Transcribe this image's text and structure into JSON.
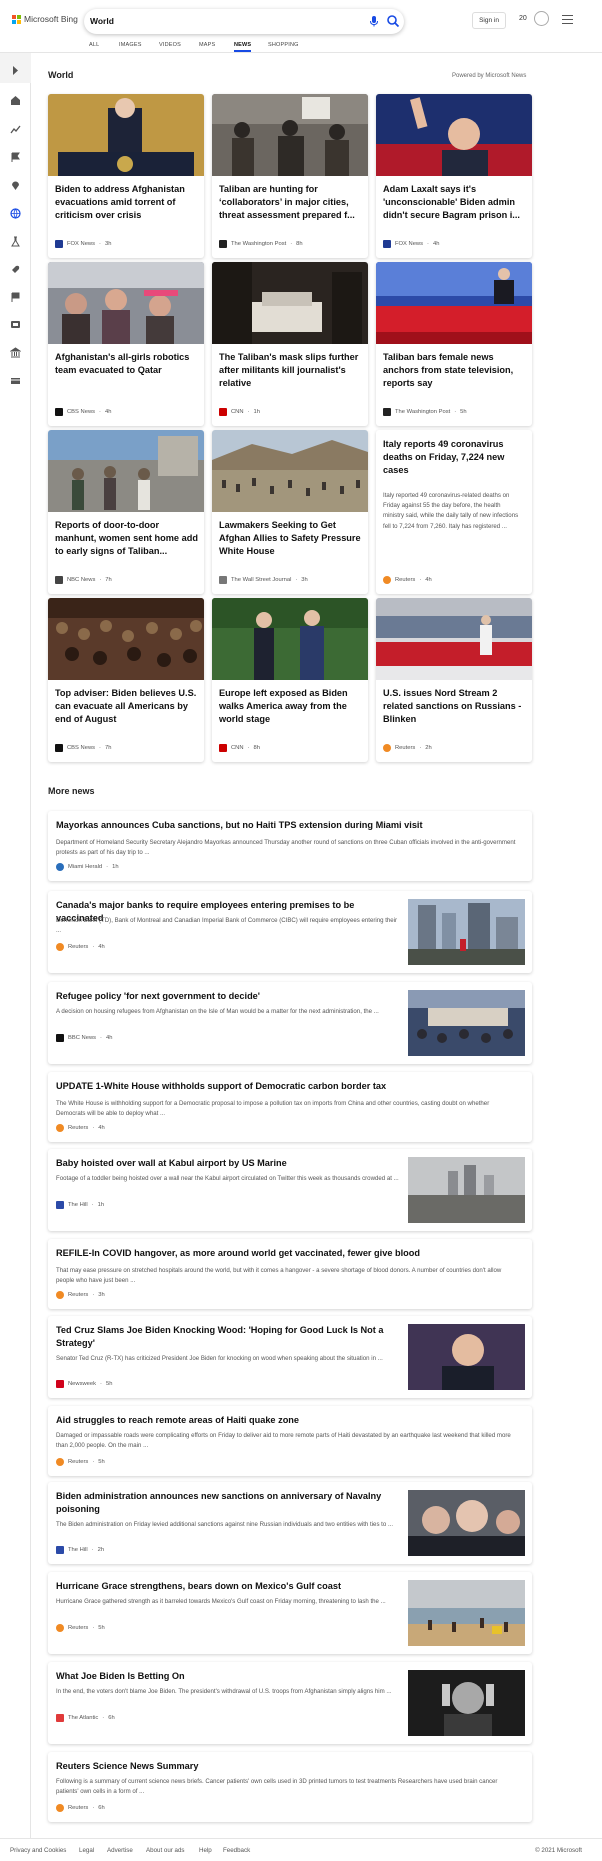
{
  "header": {
    "brand": "Microsoft Bing",
    "query": "World",
    "signin_label": "Sign in",
    "rewards_count": "20",
    "tabs": [
      {
        "label": "ALL"
      },
      {
        "label": "IMAGES"
      },
      {
        "label": "VIDEOS"
      },
      {
        "label": "MAPS"
      },
      {
        "label": "NEWS",
        "active": true
      },
      {
        "label": "SHOPPING"
      }
    ]
  },
  "rail": {
    "icons": [
      "expand-icon",
      "home-icon",
      "trending-icon",
      "flag-icon",
      "location-icon",
      "globe-icon",
      "science-icon",
      "rocket-icon",
      "flag-icon",
      "entertainment-icon",
      "politics-icon",
      "money-icon"
    ]
  },
  "section": {
    "title": "World",
    "powered_by": "Powered by Microsoft News"
  },
  "cards": [
    {
      "title": "Biden to address Afghanistan evacuations amid torrent of criticism over crisis",
      "source": "FOX News",
      "age": "3h",
      "logo_color": "#1f3a93"
    },
    {
      "title": "Taliban are hunting for ‘collaborators’ in major cities, threat assessment prepared f...",
      "source": "The Washington Post",
      "age": "8h",
      "logo_color": "#222222"
    },
    {
      "title": "Adam Laxalt says it's 'unconscionable' Biden admin didn't secure Bagram prison i...",
      "source": "FOX News",
      "age": "4h",
      "logo_color": "#1f3a93"
    },
    {
      "title": "Afghanistan's all-girls robotics team evacuated to Qatar",
      "source": "CBS News",
      "age": "4h",
      "logo_color": "#111111"
    },
    {
      "title": "The Taliban's mask slips further after militants kill journalist's relative",
      "source": "CNN",
      "age": "1h",
      "logo_color": "#cc0000"
    },
    {
      "title": "Taliban bars female news anchors from state television, reports say",
      "source": "The Washington Post",
      "age": "5h",
      "logo_color": "#222222"
    },
    {
      "title": "Reports of door-to-door manhunt, women sent home add to early signs of Taliban...",
      "source": "NBC News",
      "age": "7h",
      "logo_color": "#444444"
    },
    {
      "title": "Lawmakers Seeking to Get Afghan Allies to Safety Pressure White House",
      "source": "The Wall Street Journal",
      "age": "3h",
      "logo_color": "#777777"
    },
    {
      "title": "Italy reports 49 coronavirus deaths on Friday, 7,224 new cases",
      "description": "Italy reported 49 coronavirus-related deaths on Friday against 55 the day before, the health ministry said, while the daily tally of new infections fell to 7,224 from 7,260. Italy has registered ...",
      "source": "Reuters",
      "age": "4h",
      "logo_color": "#f08a24"
    },
    {
      "title": "Top adviser: Biden believes U.S. can evacuate all Americans by end of August",
      "source": "CBS News",
      "age": "7h",
      "logo_color": "#111111"
    },
    {
      "title": "Europe left exposed as Biden walks America away from the world stage",
      "source": "CNN",
      "age": "8h",
      "logo_color": "#cc0000"
    },
    {
      "title": "U.S. issues Nord Stream 2 related sanctions on Russians - Blinken",
      "source": "Reuters",
      "age": "2h",
      "logo_color": "#f08a24"
    }
  ],
  "more_news": {
    "title": "More news",
    "items": [
      {
        "title": "Mayorkas announces Cuba sanctions, but no Haiti TPS extension during Miami visit",
        "description": "Department of Homeland Security Secretary Alejandro Mayorkas announced Thursday another round of sanctions on three Cuban officials involved in the anti-government protests as part of his day trip to ...",
        "source": "Miami Herald",
        "age": "1h",
        "logo_color": "#2a6ebb"
      },
      {
        "title": "Canada's major banks to require employees entering premises to be vaccinated",
        "description": "Dominion Bank (TD), Bank of Montreal and Canadian Imperial Bank of Commerce (CIBC) will require employees entering their ...",
        "source": "Reuters",
        "age": "4h",
        "logo_color": "#f08a24"
      },
      {
        "title": "Refugee policy 'for next government to decide'",
        "description": "A decision on housing refugees from Afghanistan on the Isle of Man would be a matter for the next administration, the ...",
        "source": "BBC News",
        "age": "4h",
        "logo_color": "#111111"
      },
      {
        "title": "UPDATE 1-White House withholds support of Democratic carbon border tax",
        "description": "The White House is withholding support for a Democratic proposal to impose a pollution tax on imports from China and other countries, casting doubt on whether Democrats will be able to deploy what ...",
        "source": "Reuters",
        "age": "4h",
        "logo_color": "#f08a24"
      },
      {
        "title": "Baby hoisted over wall at Kabul airport by US Marine",
        "description": "Footage of a toddler being hoisted over a wall near the Kabul airport circulated on Twitter this week as thousands crowded at ...",
        "source": "The Hill",
        "age": "1h",
        "logo_color": "#2b4aa8"
      },
      {
        "title": "REFILE-In COVID hangover, as more around world get vaccinated, fewer give blood",
        "description": "That may ease pressure on stretched hospitals around the world, but with it comes a hangover - a severe shortage of blood donors. A number of countries don't allow people who have just been ...",
        "source": "Reuters",
        "age": "3h",
        "logo_color": "#f08a24"
      },
      {
        "title": "Ted Cruz Slams Joe Biden Knocking Wood: 'Hoping for Good Luck Is Not a Strategy'",
        "description": "Senator Ted Cruz (R-TX) has criticized President Joe Biden for knocking on wood when speaking about the situation in ...",
        "source": "Newsweek",
        "age": "5h",
        "logo_color": "#d0021b"
      },
      {
        "title": "Aid struggles to reach remote areas of Haiti quake zone",
        "description": "Damaged or impassable roads were complicating efforts on Friday to deliver aid to more remote parts of Haiti devastated by an earthquake last weekend that killed more than 2,000 people. On the main ...",
        "source": "Reuters",
        "age": "5h",
        "logo_color": "#f08a24"
      },
      {
        "title": "Biden administration announces new sanctions on anniversary of Navalny poisoning",
        "description": "The Biden administration on Friday levied additional sanctions against nine Russian individuals and two entities with ties to ...",
        "source": "The Hill",
        "age": "2h",
        "logo_color": "#2b4aa8"
      },
      {
        "title": "Hurricane Grace strengthens, bears down on Mexico's Gulf coast",
        "description": "Hurricane Grace gathered strength as it barreled towards Mexico's Gulf coast on Friday morning, threatening to lash the ...",
        "source": "Reuters",
        "age": "5h",
        "logo_color": "#f08a24"
      },
      {
        "title": "What Joe Biden Is Betting On",
        "description": "In the end, the voters don't blame Joe Biden. The president's withdrawal of U.S. troops from Afghanistan simply aligns him ...",
        "source": "The Atlantic",
        "age": "6h",
        "logo_color": "#e03a3a"
      },
      {
        "title": "Reuters Science News Summary",
        "description": "Following is a summary of current science news briefs. Cancer patients' own cells used in 3D printed tumors to test treatments Researchers have used brain cancer patients' own cells in a form of ...",
        "source": "Reuters",
        "age": "6h",
        "logo_color": "#f08a24"
      }
    ]
  },
  "footer": {
    "links": [
      "Privacy and Cookies",
      "Legal",
      "Advertise",
      "About our ads",
      "Help",
      "Feedback"
    ],
    "copyright": "© 2021 Microsoft"
  }
}
